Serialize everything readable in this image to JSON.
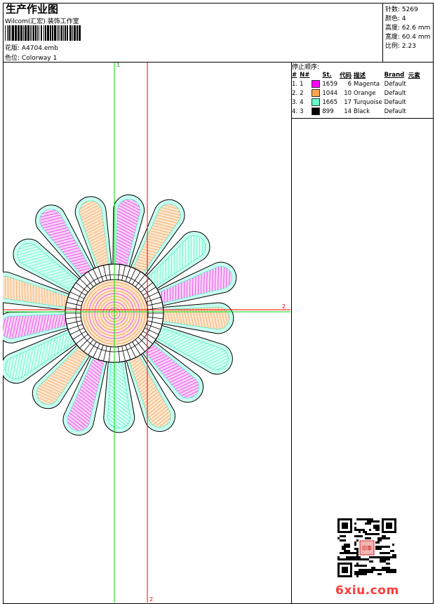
{
  "header": {
    "title": "生产作业图",
    "subtitle": "Wilcom(汇宏) 装饰工作室",
    "design_label": "花版:",
    "design_value": "A4704.emb",
    "color_label": "色位:",
    "color_value": "Colorway 1"
  },
  "stats": [
    {
      "label": "针数:",
      "value": "5269"
    },
    {
      "label": "颜色:",
      "value": "4"
    },
    {
      "label": "高度:",
      "value": "62.6 mm"
    },
    {
      "label": "宽度:",
      "value": "60.4 mm"
    },
    {
      "label": "比例:",
      "value": "2.23"
    }
  ],
  "sequence": {
    "title": "停止顺序:",
    "headers": [
      "#",
      "N#",
      "St.",
      "代码",
      "描述",
      "Brand",
      "元素"
    ],
    "rows": [
      {
        "idx": "1.",
        "n": "1",
        "color": "#ff00ff",
        "st": "1659",
        "code": "6",
        "desc": "Magenta",
        "brand": "Default"
      },
      {
        "idx": "2.",
        "n": "2",
        "color": "#ffa64d",
        "st": "1044",
        "code": "10",
        "desc": "Orange",
        "brand": "Default"
      },
      {
        "idx": "3.",
        "n": "4",
        "color": "#66ffcc",
        "st": "1665",
        "code": "17",
        "desc": "Turquoise",
        "brand": "Default"
      },
      {
        "idx": "4.",
        "n": "3",
        "color": "#000000",
        "st": "899",
        "code": "14",
        "desc": "Black",
        "brand": "Default"
      }
    ]
  },
  "guides": {
    "v1_label": "1",
    "v2_label": "2",
    "h_label": "2"
  },
  "watermark": "6xiu.com",
  "qr_stamp": "印章"
}
